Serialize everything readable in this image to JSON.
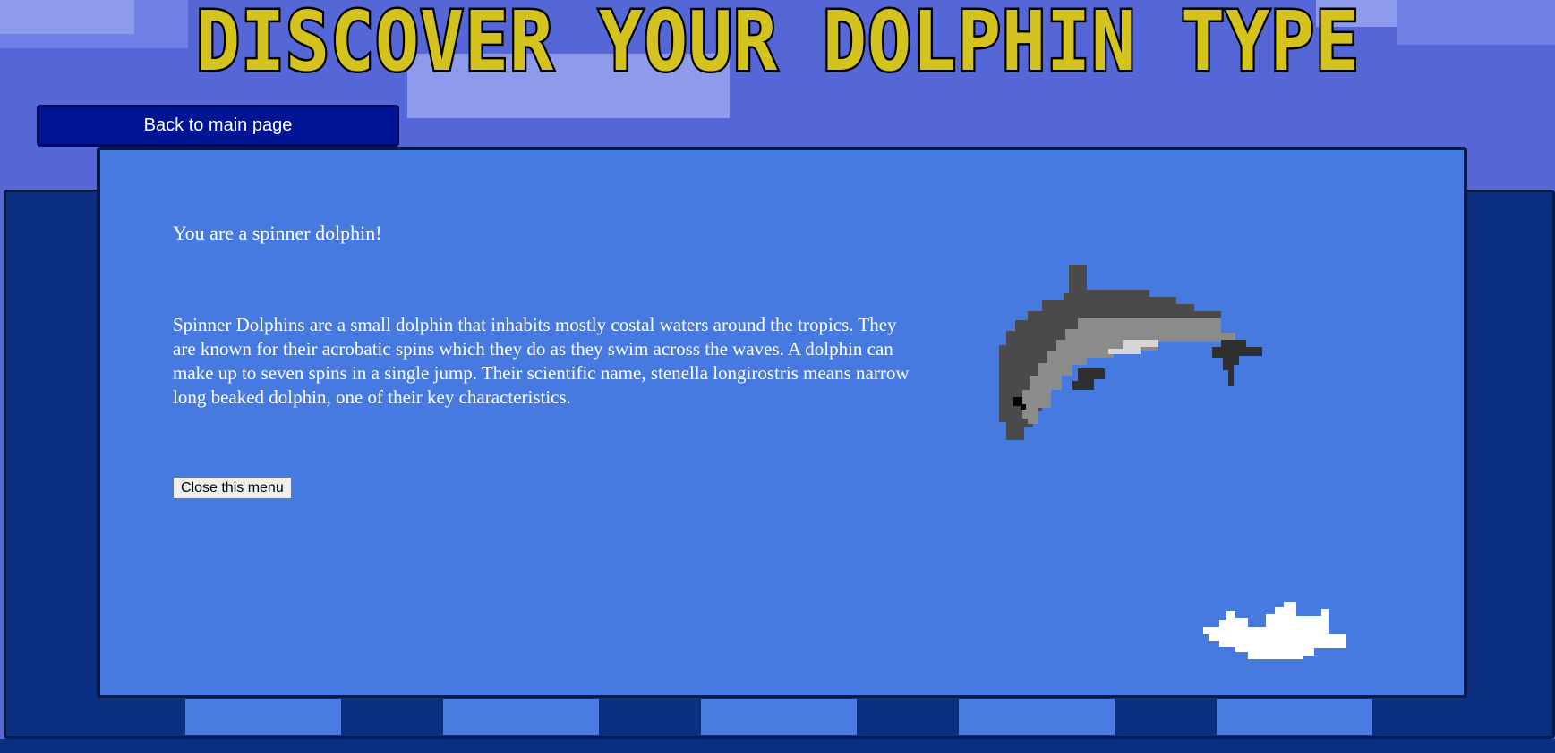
{
  "page": {
    "title": "DISCOVER YOUR DOLPHIN TYPE",
    "title_color": "#d4c21f",
    "background_color": "#5567d6"
  },
  "nav": {
    "back_label": "Back to main page"
  },
  "result": {
    "heading": "You are a spinner dolphin!",
    "description": "Spinner Dolphins are a small dolphin that inhabits mostly costal waters around the tropics. They are known for their acrobatic spins which they do as they swim across the waves. A dolphin can make up to seven spins in a single jump. Their scientific name, stenella longirostris means narrow long beaked dolphin, one of their key characteristics.",
    "close_label": "Close this menu",
    "illustration": "spinner-dolphin-pixel-art",
    "splash": "water-splash-icon"
  },
  "colors": {
    "popup": "#477ae0",
    "panel": "#0a2f80",
    "button": "#001594"
  }
}
